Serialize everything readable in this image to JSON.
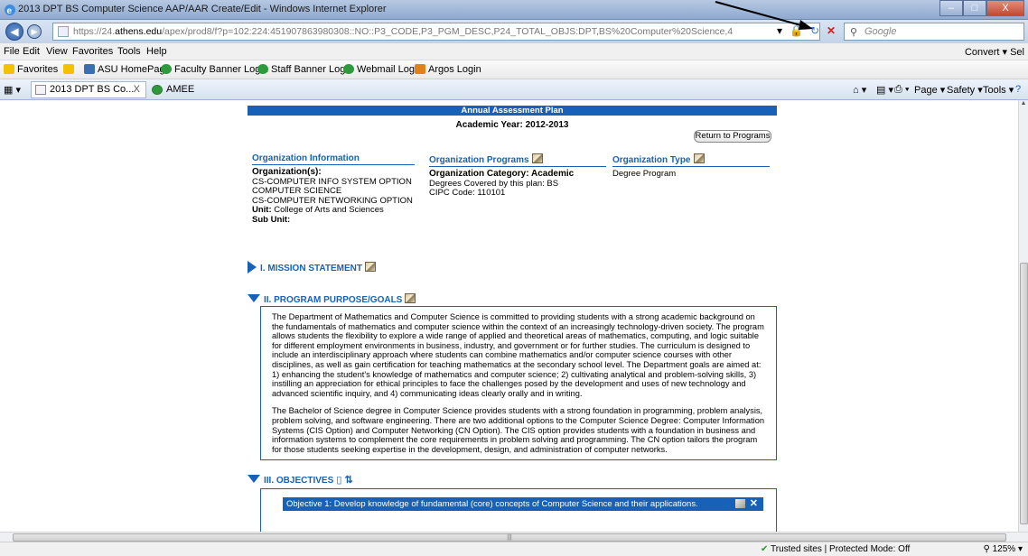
{
  "window": {
    "title": "2013 DPT BS Computer Science AAP/AAR Create/Edit - Windows Internet Explorer",
    "controls": [
      "–",
      "□",
      "X"
    ]
  },
  "address": {
    "url_prefix": "https://24.",
    "url_domain": "athens.edu",
    "url_rest": "/apex/prod8/f?p=102:224:451907863980308::NO::P3_CODE,P3_PGM_DESC,P24_TOTAL_OBJS:DPT,BS%20Computer%20Science,4",
    "search_placeholder": "Google"
  },
  "menu": [
    "File",
    "Edit",
    "View",
    "Favorites",
    "Tools",
    "Help"
  ],
  "menu_right": "Convert ▾ Sel",
  "favorites": {
    "label": "Favorites",
    "items": [
      "ASU HomePage",
      "Faculty Banner Login",
      "Staff Banner Login",
      "Webmail Login",
      "Argos Login"
    ]
  },
  "tabs": [
    {
      "label": "2013 DPT BS Co...",
      "close": "X"
    },
    {
      "label": "AMEE"
    }
  ],
  "commands": [
    "Page ▾",
    "Safety ▾",
    "Tools ▾"
  ],
  "page": {
    "banner": "Annual Assessment Plan",
    "academic_year": "Academic Year: 2012-2013",
    "return_button": "Return to Programs",
    "org_info": {
      "heading": "Organization Information",
      "orgs_label": "Organization(s):",
      "orgs": [
        "CS-COMPUTER INFO SYSTEM OPTION",
        "COMPUTER SCIENCE",
        "CS-COMPUTER NETWORKING OPTION"
      ],
      "unit_label": "Unit:",
      "unit": "College of Arts and Sciences",
      "subunit_label": "Sub Unit:"
    },
    "org_programs": {
      "heading": "Organization Programs",
      "category": "Organization Category: Academic",
      "degrees": "Degrees Covered by this plan: BS",
      "cipc": "CIPC Code: 110101"
    },
    "org_type": {
      "heading": "Organization Type",
      "value": "Degree Program"
    },
    "mission": "I. MISSION STATEMENT",
    "goals": {
      "heading": "II. PROGRAM PURPOSE/GOALS",
      "p1": "The Department of Mathematics and Computer Science is committed to providing students with a strong academic background on the fundamentals of mathematics and computer science within the context of an increasingly technology-driven society. The program allows students the flexibility to explore a wide range of applied and theoretical areas of mathematics, computing, and logic suitable for different employment environments in business, industry, and government or for further studies. The curriculum is designed to include an interdisciplinary approach where students can combine mathematics and/or computer science courses with other disciplines, as well as gain certification for teaching mathematics at the secondary school level. The Department goals are aimed at: 1) enhancing the student's knowledge of mathematics and computer science; 2) cultivating analytical and problem-solving skills, 3) instilling an appreciation for ethical principles to face the challenges posed by the development and uses of new technology and advanced scientific inquiry, and 4) communicating ideas clearly orally and in writing.",
      "p2": "The Bachelor of Science degree in Computer Science provides students with a strong foundation in programming, problem analysis, problem solving, and software engineering. There are two additional options to the Computer Science Degree: Computer Information Systems (CIS Option) and Computer Networking (CN Option). The CIS option provides students with a foundation in business and information systems to complement the core requirements in problem solving and programming. The CN option tailors the program for those students seeking expertise in the development, design, and administration of computer networks."
    },
    "objectives": {
      "heading": "III. OBJECTIVES",
      "items": [
        "Objective 1: Develop knowledge of fundamental (core) concepts of Computer Science and their applications."
      ]
    }
  },
  "status": {
    "trusted": "Trusted sites | Protected Mode: Off",
    "zoom": "125%"
  }
}
